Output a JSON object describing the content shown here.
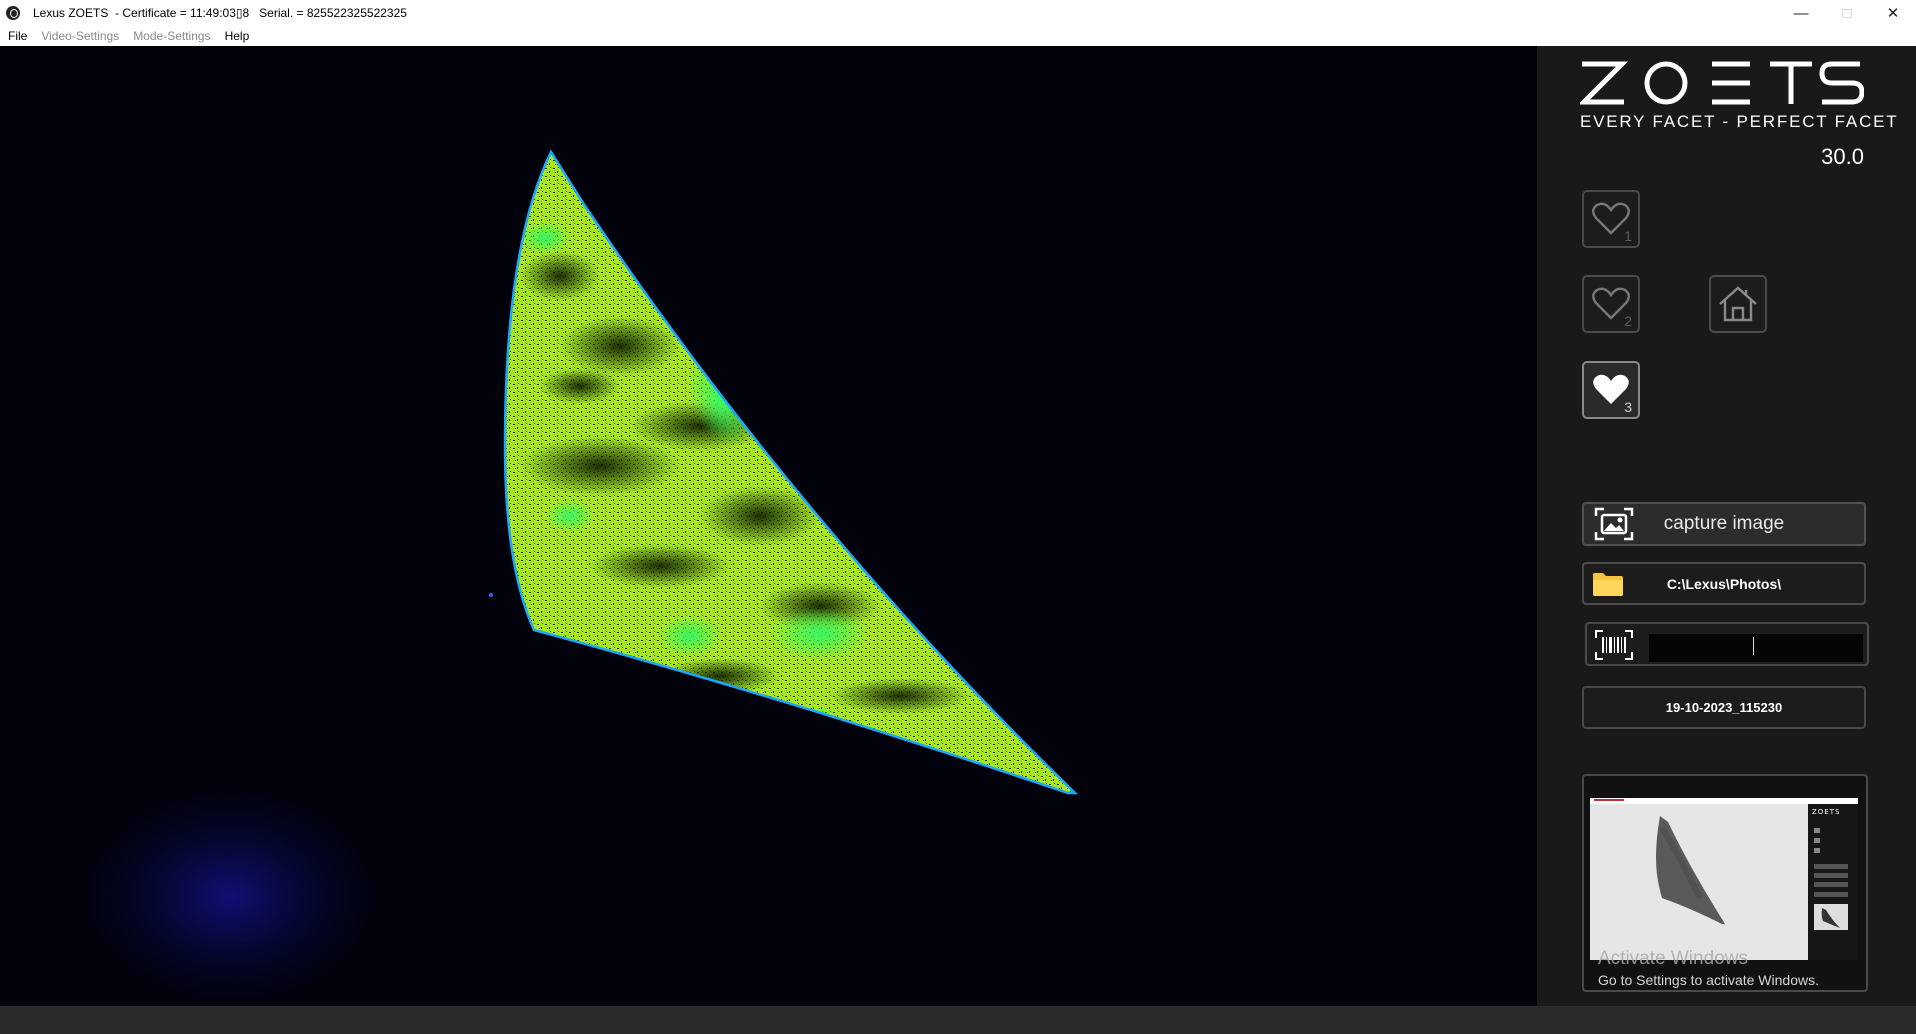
{
  "window": {
    "title": "Lexus ZOETS  - Certificate = 11:49:03▯8   Serial. = 825522325522325",
    "controls": {
      "minimize": "—",
      "maximize": "□",
      "close": "✕"
    }
  },
  "menu": {
    "items": [
      {
        "label": "File",
        "enabled": true
      },
      {
        "label": "Video-Settings",
        "enabled": false
      },
      {
        "label": "Mode-Settings",
        "enabled": false
      },
      {
        "label": "Help",
        "enabled": true
      }
    ]
  },
  "brand": {
    "logo": "ZOETS",
    "tagline": "EVERY FACET - PERFECT FACET",
    "fps_value": "30.0"
  },
  "favorites": [
    {
      "number": "1",
      "icon": "heart-outline-icon",
      "active": false
    },
    {
      "number": "2",
      "icon": "heart-outline-icon",
      "active": false
    },
    {
      "number": "3",
      "icon": "heart-filled-icon",
      "active": true
    }
  ],
  "home": {
    "icon": "home-icon"
  },
  "capture": {
    "label": "capture image",
    "icon": "capture-image-icon"
  },
  "save_path": {
    "path": "C:\\Lexus\\Photos\\",
    "icon": "folder-icon"
  },
  "barcode": {
    "icon": "barcode-scan-icon",
    "value": ""
  },
  "filename": {
    "value": "19-10-2023_115230"
  },
  "thumbnail": {
    "watermark_title": "Activate Windows",
    "watermark_subtitle": "Go to Settings to activate Windows."
  },
  "colors": {
    "stone_fill": "#9ae61a",
    "stone_highlight": "#2cf05a",
    "stone_outline": "#1aa8ff",
    "video_bg": "#01020c",
    "panel_bg": "#191919"
  }
}
